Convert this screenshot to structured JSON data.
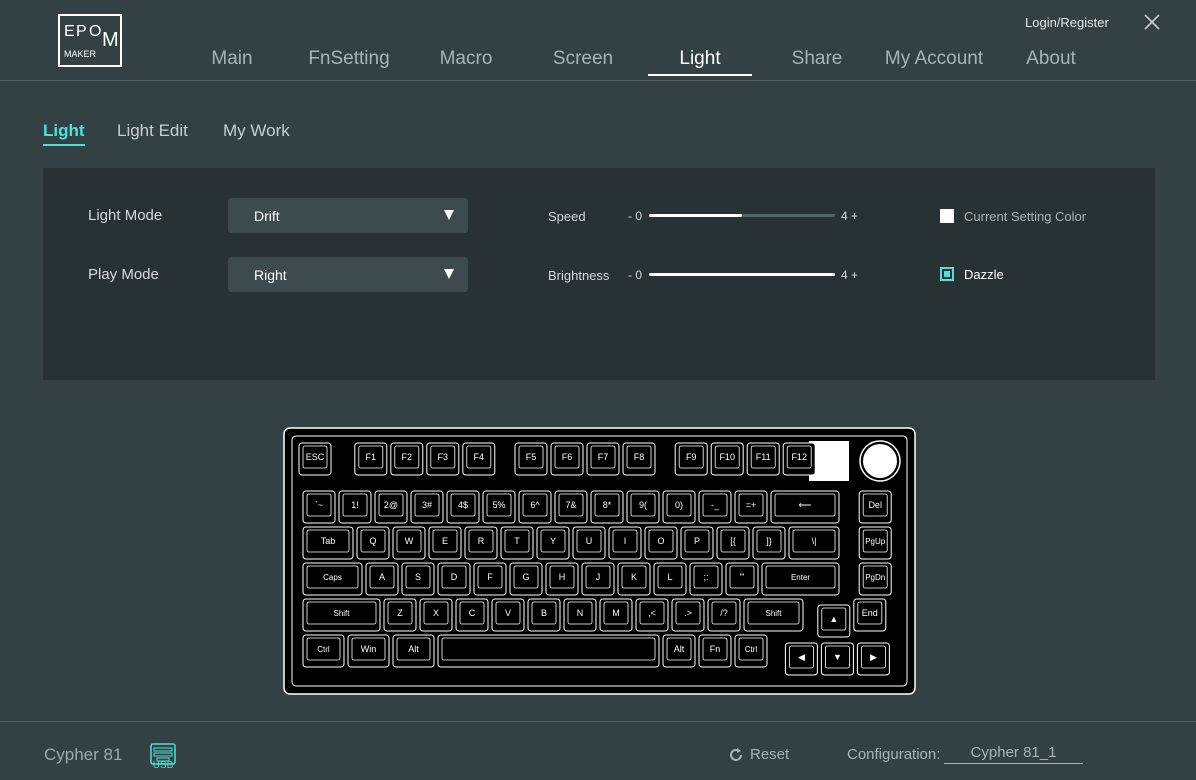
{
  "brand": {
    "logo_letters": [
      "E",
      "P",
      "O",
      "M"
    ],
    "logo_sub": "MAKER"
  },
  "nav": {
    "tabs": [
      "Main",
      "FnSetting",
      "Macro",
      "Screen",
      "Light",
      "Share",
      "My Account",
      "About"
    ],
    "active": "Light",
    "login": "Login/Register"
  },
  "subtabs": {
    "items": [
      "Light",
      "Light Edit",
      "My Work"
    ],
    "active": "Light"
  },
  "settings": {
    "light_mode": {
      "label": "Light Mode",
      "value": "Drift"
    },
    "play_mode": {
      "label": "Play Mode",
      "value": "Right"
    },
    "speed": {
      "label": "Speed",
      "min": "- 0",
      "max": "4 +",
      "fraction": 0.5
    },
    "brightness": {
      "label": "Brightness",
      "min": "- 0",
      "max": "4 +",
      "fraction": 1.0
    },
    "current_setting_color": {
      "label": "Current Setting Color",
      "checked": false
    },
    "dazzle": {
      "label": "Dazzle",
      "checked": true
    }
  },
  "keyboard": {
    "rows": [
      [
        "ESC",
        "F1",
        "F2",
        "F3",
        "F4",
        "F5",
        "F6",
        "F7",
        "F8",
        "F9",
        "F10",
        "F11",
        "F12"
      ],
      [
        "`~",
        "1!",
        "2@",
        "3#",
        "4$",
        "5%",
        "6^",
        "7&",
        "8*",
        "9(",
        "0)",
        "-_",
        "=+",
        "⟵",
        "Del"
      ],
      [
        "Tab",
        "Q",
        "W",
        "E",
        "R",
        "T",
        "Y",
        "U",
        "I",
        "O",
        "P",
        "[{",
        "]}",
        "\\|",
        "PgUp"
      ],
      [
        "Caps",
        "A",
        "S",
        "D",
        "F",
        "G",
        "H",
        "J",
        "K",
        "L",
        ";:",
        "'\"",
        "Enter",
        "PgDn"
      ],
      [
        "Shift",
        "Z",
        "X",
        "C",
        "V",
        "B",
        "N",
        "M",
        ",<",
        ".>",
        "/?",
        "Shift",
        "▲",
        "End"
      ],
      [
        "Ctrl",
        "Win",
        "Alt",
        "",
        "Alt",
        "Fn",
        "Ctrl",
        "◀",
        "▼",
        "▶"
      ]
    ]
  },
  "footer": {
    "device": "Cypher 81",
    "connection": "USB",
    "reset": "Reset",
    "config_label": "Configuration:",
    "config_value": "Cypher 81_1"
  },
  "colors": {
    "accent": "#4fe0dc",
    "background": "#334144",
    "panel": "#283134"
  }
}
